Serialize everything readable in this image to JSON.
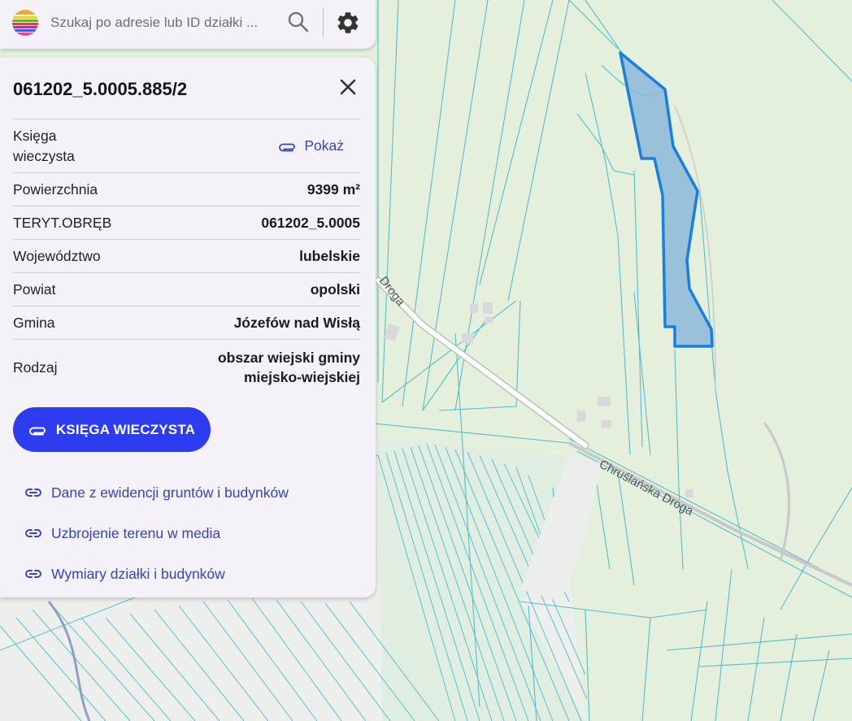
{
  "search": {
    "placeholder": "Szukaj po adresie lub ID działki ..."
  },
  "parcel": {
    "id": "061202_5.0005.885/2",
    "rows": [
      {
        "label": "Księga\nwieczysta",
        "link_label": "Pokaż"
      },
      {
        "label": "Powierzchnia",
        "value": "9399 m²"
      },
      {
        "label": "TERYT.OBRĘB",
        "value": "061202_5.0005"
      },
      {
        "label": "Województwo",
        "value": "lubelskie"
      },
      {
        "label": "Powiat",
        "value": "opolski"
      },
      {
        "label": "Gmina",
        "value": "Józefów nad Wisłą"
      },
      {
        "label": "Rodzaj",
        "value": "obszar wiejski gminy miejsko-wiejskiej"
      }
    ]
  },
  "actions": {
    "kw_button": "KSIĘGA WIECZYSTA",
    "links": [
      "Dane z ewidencji gruntów i budynków",
      "Uzbrojenie terenu w media",
      "Wymiary działki i budynków"
    ]
  },
  "map": {
    "road_labels": [
      "Droga",
      "Chruślańska Droga"
    ]
  },
  "colors": {
    "accent": "#2e3cf0",
    "link": "#3346b8",
    "parcel_fill": "#8db8d9",
    "parcel_stroke": "#1a7ee0",
    "parcel_lines": "#4bb8cc"
  },
  "icons": {
    "logo": "rainbow-stripes-logo",
    "search": "search-icon",
    "settings": "gear-icon",
    "close": "close-icon",
    "attachment": "paperclip-icon",
    "link": "link-icon"
  }
}
